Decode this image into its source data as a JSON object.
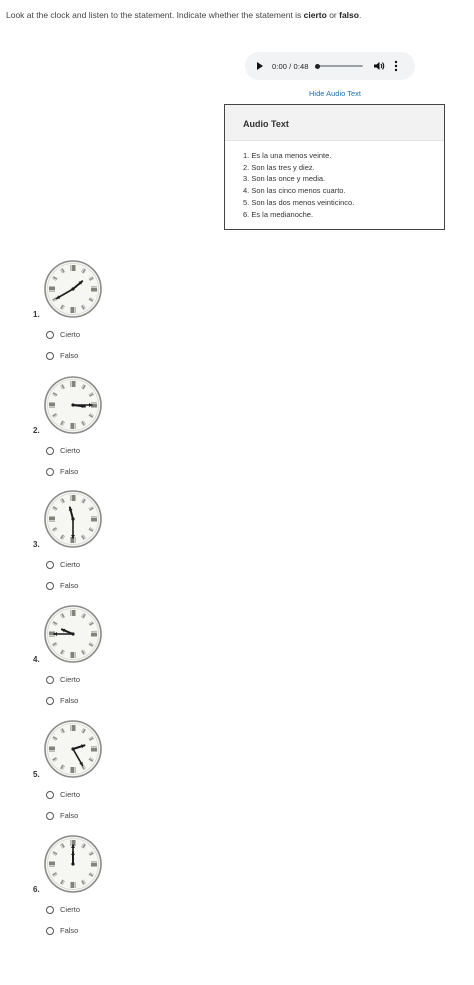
{
  "instructions": {
    "prefix": "Look at the clock and listen to the statement. Indicate whether the statement is ",
    "bold1": "cierto",
    "middle": " or ",
    "bold2": "falso",
    "suffix": "."
  },
  "audio_player": {
    "time": "0:00 / 0:48",
    "progress_fraction": 0,
    "icons": [
      "play-icon",
      "volume-icon",
      "more-options-icon"
    ]
  },
  "hide_link": "Hide Audio Text",
  "audio_text": {
    "title": "Audio Text",
    "lines": [
      "1. Es la una menos veinte.",
      "2. Son las tres y diez.",
      "3. Son las once y media.",
      "4. Son las cinco menos cuarto.",
      "5. Son las dos menos veinticinco.",
      "6. Es la medianoche."
    ]
  },
  "questions": [
    {
      "number": "1.",
      "clock_time": "1:40",
      "options": [
        "Cierto",
        "Falso"
      ]
    },
    {
      "number": "2.",
      "clock_time": "3:15",
      "options": [
        "Cierto",
        "Falso"
      ]
    },
    {
      "number": "3.",
      "clock_time": "11:30",
      "options": [
        "Cierto",
        "Falso"
      ]
    },
    {
      "number": "4.",
      "clock_time": "9:45",
      "options": [
        "Cierto",
        "Falso"
      ]
    },
    {
      "number": "5.",
      "clock_time": "2:25",
      "options": [
        "Cierto",
        "Falso"
      ]
    },
    {
      "number": "6.",
      "clock_time": "12:00",
      "options": [
        "Cierto",
        "Falso"
      ]
    }
  ],
  "colors": {
    "link": "#1a6fb3",
    "player_bg": "#f1f3f4",
    "clock_face": "#f6f6f2"
  }
}
